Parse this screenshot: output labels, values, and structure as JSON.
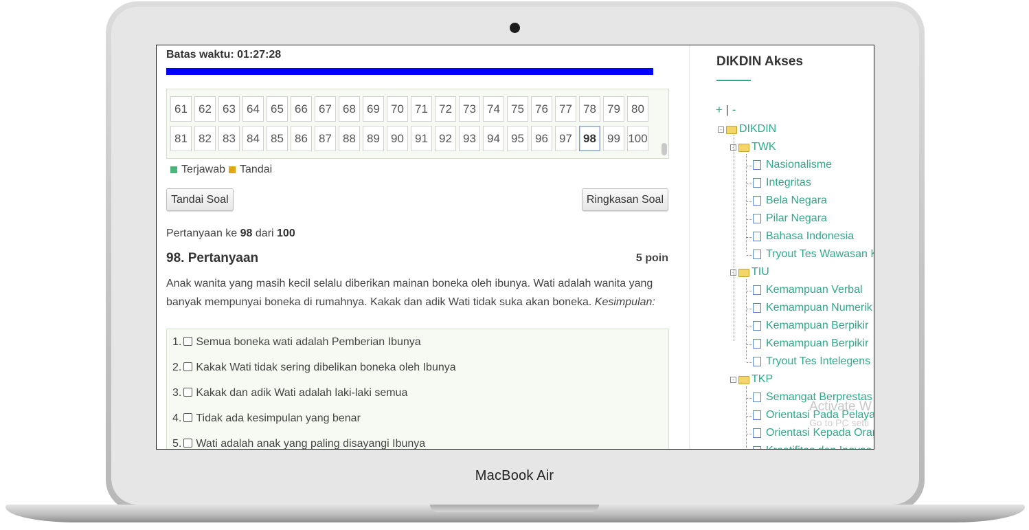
{
  "device": {
    "brand": "MacBook Air"
  },
  "timer": {
    "label": "Batas waktu: 01:27:28",
    "progress": 0.97
  },
  "navigator": {
    "row_a": [
      "61",
      "62",
      "63",
      "64",
      "65",
      "66",
      "67",
      "68",
      "69",
      "70",
      "71",
      "72",
      "73",
      "74",
      "75",
      "76",
      "77",
      "78",
      "79",
      "80"
    ],
    "row_b": [
      "81",
      "82",
      "83",
      "84",
      "85",
      "86",
      "87",
      "88",
      "89",
      "90",
      "91",
      "92",
      "93",
      "94",
      "95",
      "96",
      "97",
      "98",
      "99",
      "100"
    ],
    "active": "98"
  },
  "legend": {
    "answered": "Terjawab",
    "flagged": "Tandai",
    "answered_color": "#4bb57c",
    "flagged_color": "#e0a614"
  },
  "buttons": {
    "flag": "Tandai Soal",
    "summary": "Ringkasan Soal"
  },
  "question": {
    "info_prefix": "Pertanyaan ke",
    "number": "98",
    "info_mid": "dari",
    "total": "100",
    "title": "98. Pertanyaan",
    "points": "5 poin",
    "text": "Anak wanita yang masih kecil selalu diberikan mainan boneka oleh ibunya. Wati adalah wanita yang banyak mempunyai boneka di rumahnya. Kakak dan adik Wati tidak suka akan boneka.",
    "text_italic": "Kesimpulan:",
    "options": [
      {
        "num": "1.",
        "text": "Semua boneka wati adalah Pemberian Ibunya"
      },
      {
        "num": "2.",
        "text": "Kakak Wati tidak sering dibelikan boneka oleh Ibunya"
      },
      {
        "num": "3.",
        "text": "Kakak dan adik Wati adalah laki-laki semua"
      },
      {
        "num": "4.",
        "text": "Tidak ada kesimpulan yang benar"
      },
      {
        "num": "5.",
        "text": "Wati adalah anak yang paling disayangi Ibunya"
      }
    ]
  },
  "sidebar": {
    "title": "DIKDIN Akses",
    "expand": "+",
    "sep": "|",
    "collapse": "-",
    "root": "DIKDIN",
    "groups": [
      {
        "name": "TWK",
        "items": [
          "Nasionalisme",
          "Integritas",
          "Bela Negara",
          "Pilar Negara",
          "Bahasa Indonesia",
          "Tryout Tes Wawasan K"
        ]
      },
      {
        "name": "TIU",
        "items": [
          "Kemampuan Verbal",
          "Kemampuan Numerik",
          "Kemampuan Berpikir",
          "Kemampuan Berpikir",
          "Tryout Tes Intelegens"
        ]
      },
      {
        "name": "TKP",
        "items": [
          "Semangat Berprestas",
          "Orientasi Pada Pelaya",
          "Orientasi Kepada Oran",
          "Kreatifitas dan Inovas"
        ]
      }
    ]
  },
  "watermark": {
    "line1": "Activate W",
    "line2": "Go to PC setti"
  },
  "colors": {
    "accent": "#2ea98a",
    "timer_bar": "#0000ff"
  }
}
